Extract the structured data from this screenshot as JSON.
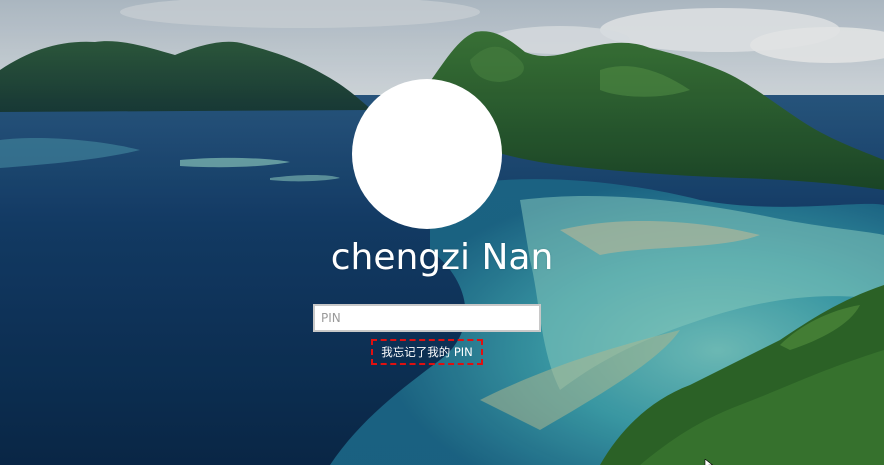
{
  "lock_screen": {
    "background": "tropical-lagoon-photo",
    "user": {
      "display_name": "chengzi Nan",
      "avatar": "blank-avatar"
    },
    "pin_input": {
      "placeholder": "PIN",
      "value": ""
    },
    "forgot_pin_link": {
      "label": "我忘记了我的 PIN",
      "highlight_color": "#e01010"
    }
  },
  "colors": {
    "deep_water": "#0f3560",
    "lagoon": "#3fb7c0",
    "forest": "#2f6a2a",
    "sky": "#cfd8df",
    "text": "#ffffff"
  },
  "icons": [
    "mouse-pointer-icon"
  ]
}
